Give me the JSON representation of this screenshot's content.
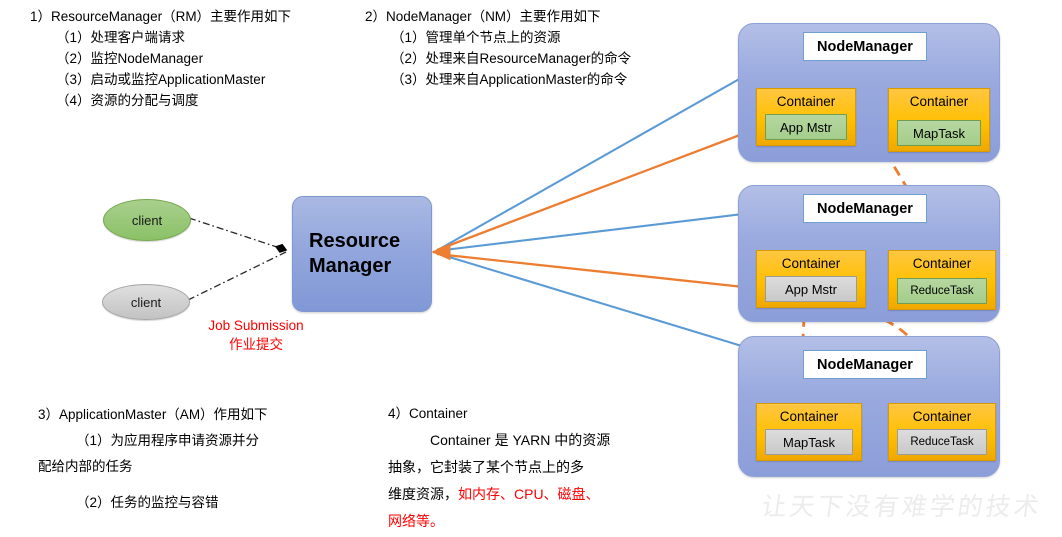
{
  "texts": {
    "rm_section": {
      "heading": "1）ResourceManager（RM）主要作用如下",
      "items": [
        "（1）处理客户端请求",
        "（2）监控NodeManager",
        "（3）启动或监控ApplicationMaster",
        "（4）资源的分配与调度"
      ]
    },
    "nm_section": {
      "heading": "2）NodeManager（NM）主要作用如下",
      "items": [
        "（1）管理单个节点上的资源",
        "（2）处理来自ResourceManager的命令",
        "（3）处理来自ApplicationMaster的命令"
      ]
    },
    "am_section": {
      "heading": "3）ApplicationMaster（AM）作用如下",
      "line1": "（1）为应用程序申请资源并分",
      "line2": "配给内部的任务",
      "line3": "（2）任务的监控与容错"
    },
    "container_section": {
      "heading": "4）Container",
      "line1": "Container 是 YARN 中的资源",
      "line2": "抽象，它封装了某个节点上的多",
      "line3_black": "维度资源，",
      "line3_red": "如内存、CPU、磁盘、",
      "line4_red": "网络等。"
    }
  },
  "diagram": {
    "clients": [
      {
        "label": "client",
        "color": "#a9d08e"
      },
      {
        "label": "client",
        "color": "#c3c3c3"
      }
    ],
    "resource_manager": {
      "line1": "Resource",
      "line2": "Manager"
    },
    "job_submission": {
      "line1": "Job Submission",
      "line2": "作业提交"
    },
    "node_managers": [
      {
        "label": "NodeManager",
        "containers": [
          {
            "title": "Container",
            "task": "App Mstr",
            "task_style": "green"
          },
          {
            "title": "Container",
            "task": "MapTask",
            "task_style": "green"
          }
        ]
      },
      {
        "label": "NodeManager",
        "containers": [
          {
            "title": "Container",
            "task": "App Mstr",
            "task_style": "gray"
          },
          {
            "title": "Container",
            "task": "ReduceTask",
            "task_style": "green"
          }
        ]
      },
      {
        "label": "NodeManager",
        "containers": [
          {
            "title": "Container",
            "task": "MapTask",
            "task_style": "gray"
          },
          {
            "title": "Container",
            "task": "ReduceTask",
            "task_style": "gray"
          }
        ]
      }
    ],
    "watermark": "让天下没有难学的技术"
  },
  "colors": {
    "blue_arrow": "#5b9bd5",
    "orange_arrow": "#ed7d31",
    "panel_blue": "#97a8dc",
    "container_orange": "#ffc000",
    "task_green": "#a9d08e",
    "accent_red": "#ff0000"
  }
}
